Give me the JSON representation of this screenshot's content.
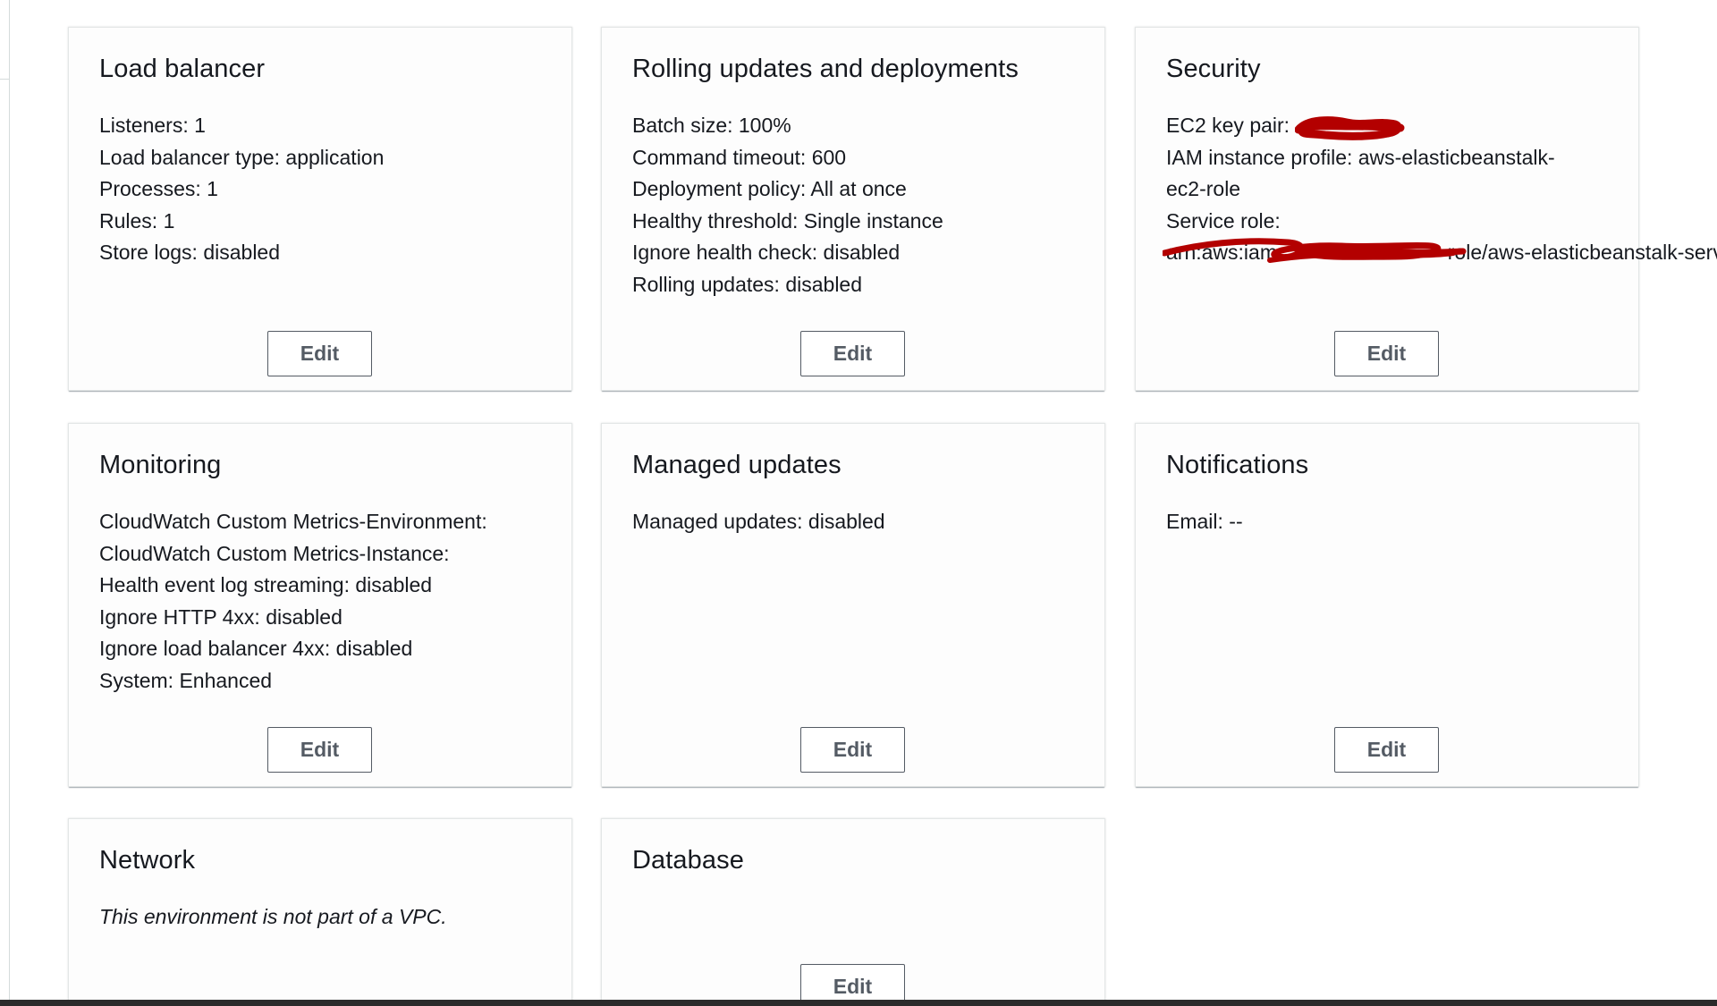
{
  "cards": {
    "load_balancer": {
      "title": "Load balancer",
      "lines": [
        "Listeners: 1",
        "Load balancer type: application",
        "Processes: 1",
        "Rules: 1",
        "Store logs: disabled"
      ],
      "edit_label": "Edit"
    },
    "rolling_updates": {
      "title": "Rolling updates and deployments",
      "lines": [
        "Batch size: 100%",
        "Command timeout: 600",
        "Deployment policy: All at once",
        "Healthy threshold: Single instance",
        "Ignore health check: disabled",
        "Rolling updates: disabled"
      ],
      "edit_label": "Edit"
    },
    "security": {
      "title": "Security",
      "ec2_key_pair_label": "EC2 key pair:",
      "iam_instance_profile": "IAM instance profile: aws-elasticbeanstalk-ec2-role",
      "service_role_label": "Service role:",
      "service_role_value_start": "arn:aws:iam::",
      "service_role_value_end": "role/aws-elasticbeanstalk-service-role",
      "redaction_color": "#b30000",
      "edit_label": "Edit"
    },
    "monitoring": {
      "title": "Monitoring",
      "lines": [
        "CloudWatch Custom Metrics-Environment:",
        "CloudWatch Custom Metrics-Instance:",
        "Health event log streaming: disabled",
        "Ignore HTTP 4xx: disabled",
        "Ignore load balancer 4xx: disabled",
        "System: Enhanced"
      ],
      "edit_label": "Edit"
    },
    "managed_updates": {
      "title": "Managed updates",
      "lines": [
        "Managed updates: disabled"
      ],
      "edit_label": "Edit"
    },
    "notifications": {
      "title": "Notifications",
      "lines": [
        "Email: --"
      ],
      "edit_label": "Edit"
    },
    "network": {
      "title": "Network",
      "note": "This environment is not part of a VPC."
    },
    "database": {
      "title": "Database",
      "edit_label": "Edit"
    }
  },
  "colors": {
    "text": "#16191f",
    "button_border": "#545b64",
    "card_background": "#fdfdfd",
    "bottom_bar": "#2b2b2b"
  }
}
